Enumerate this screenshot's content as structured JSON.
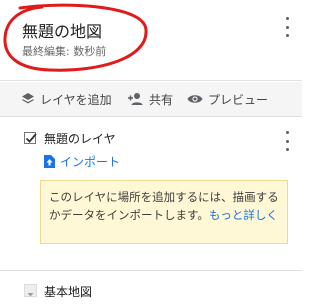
{
  "header": {
    "map_title": "無題の地図",
    "last_edited": "最終編集: 数秒前",
    "highlight_color": "#e01b1b"
  },
  "toolbar": {
    "add_layer_label": "レイヤを追加",
    "share_label": "共有",
    "preview_label": "プレビュー"
  },
  "layer": {
    "name": "無題のレイヤ",
    "checked": true,
    "import_label": "インポート",
    "tip_text": "このレイヤに場所を追加するには、描画するかデータをインポートします。",
    "tip_link": "もっと詳しく"
  },
  "basemap": {
    "label": "基本地図"
  },
  "icons": {
    "more_top": "more-vert-icon",
    "add_layer": "layers-icon",
    "share": "person-add-icon",
    "preview": "eye-icon",
    "import": "file-upload-icon",
    "basemap": "chevron-down-icon"
  }
}
